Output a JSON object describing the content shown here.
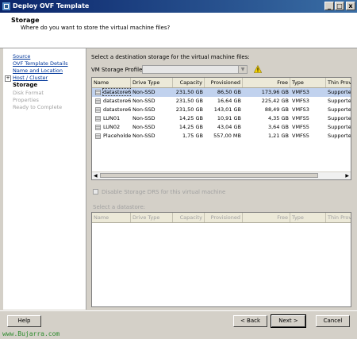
{
  "window": {
    "title": "Deploy OVF Template",
    "btn_min": "_",
    "btn_max": "□",
    "btn_close": "x"
  },
  "header": {
    "title": "Storage",
    "subtitle": "Where do you want to store the virtual machine files?"
  },
  "steps": [
    {
      "label": "Source",
      "state": "link"
    },
    {
      "label": "OVF Template Details",
      "state": "link"
    },
    {
      "label": "Name and Location",
      "state": "link"
    },
    {
      "label": "Host / Cluster",
      "state": "link"
    },
    {
      "label": "Storage",
      "state": "current"
    },
    {
      "label": "Disk Format",
      "state": "disabled"
    },
    {
      "label": "Properties",
      "state": "disabled"
    },
    {
      "label": "Ready to Complete",
      "state": "disabled"
    }
  ],
  "storage": {
    "instruction": "Select a destination storage for the virtual machine files:",
    "profile_label": "VM Storage Profile:",
    "profile_value": "",
    "columns": [
      "Name",
      "Drive Type",
      "Capacity",
      "Provisioned",
      "Free",
      "Type",
      "Thin Prov"
    ],
    "rows": [
      [
        "datastore6-1",
        "Non-SSD",
        "231,50 GB",
        "86,50 GB",
        "173,96 GB",
        "VMFS3",
        "Supporte"
      ],
      [
        "datastore6-2",
        "Non-SSD",
        "231,50 GB",
        "16,64 GB",
        "225,42 GB",
        "VMFS3",
        "Supporte"
      ],
      [
        "datastore6-3",
        "Non-SSD",
        "231,50 GB",
        "143,01 GB",
        "88,49 GB",
        "VMFS3",
        "Supporte"
      ],
      [
        "LUN01",
        "Non-SSD",
        "14,25 GB",
        "10,91 GB",
        "4,35 GB",
        "VMFS5",
        "Supporte"
      ],
      [
        "LUN02",
        "Non-SSD",
        "14,25 GB",
        "43,04 GB",
        "3,64 GB",
        "VMFS5",
        "Supporte"
      ],
      [
        "Placeholder6il",
        "Non-SSD",
        "1,75 GB",
        "557,00 MB",
        "1,21 GB",
        "VMFS5",
        "Supporte"
      ]
    ],
    "selected_row": 0,
    "disable_drs_label": "Disable Storage DRS for this virtual machine",
    "select_datastore_label": "Select a datastore:",
    "columns2": [
      "Name",
      "Drive Type",
      "Capacity",
      "Provisioned",
      "Free",
      "Type",
      "Thin Prov"
    ]
  },
  "buttons": {
    "help": "Help",
    "back": "< Back",
    "next": "Next >",
    "cancel": "Cancel"
  },
  "watermark": "www.Bujarra.com",
  "colors": {
    "title_bar": "#0a246a",
    "selection": "#c1d2ee",
    "link": "#00369a",
    "watermark": "#2e8b2e"
  }
}
